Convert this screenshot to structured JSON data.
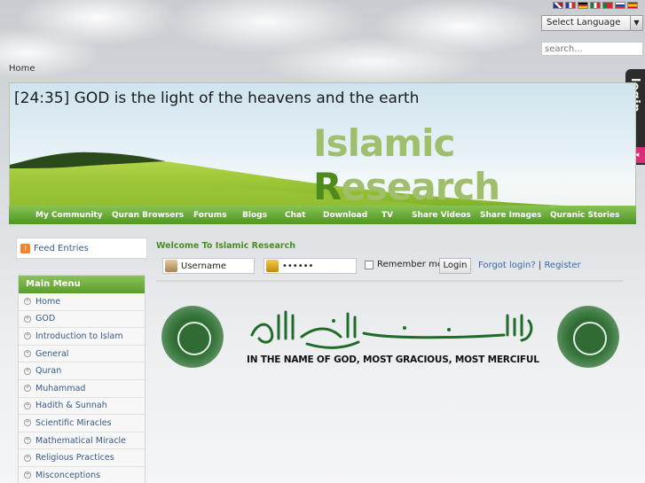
{
  "top": {
    "flags": [
      "flag-uk",
      "flag-fr",
      "flag-de",
      "flag-it",
      "flag-pt",
      "flag-ru",
      "flag-es"
    ],
    "language_select": "Select Language",
    "search_placeholder": "search..."
  },
  "breadcrumb": "Home",
  "login_tab": "login",
  "banner": {
    "verse": "[24:35] GOD is the light of the heavens and the earth",
    "brand_part1": "Islamic ",
    "brand_part2": "R",
    "brand_part3": "esearch"
  },
  "nav": [
    "My Community",
    "Quran Browsers",
    "Forums",
    "Blogs",
    "Chat",
    "Download",
    "TV",
    "Share Videos",
    "Share Images",
    "Quranic Stories"
  ],
  "feed": "Feed Entries",
  "main_menu": {
    "title": "Main Menu",
    "items": [
      "Home",
      "GOD",
      "Introduction to Islam",
      "General",
      "Quran",
      "Muhammad",
      "Hadith & Sunnah",
      "Scientific Miracles",
      "Mathematical Miracle",
      "Religious Practices",
      "Misconceptions"
    ]
  },
  "content": {
    "welcome": "Welcome To Islamic Research",
    "username_value": "Username",
    "password_value": "••••••",
    "remember": "Remember me",
    "login_button": "Login",
    "forgot": "Forgot login?",
    "separator": "|",
    "register": "Register",
    "caption": "IN THE NAME OF GOD, MOST GRACIOUS, MOST MERCIFUL"
  },
  "colors": {
    "accent_green": "#5b9c2c",
    "link_blue": "#3a5a86",
    "brand_light": "#9fbf6c",
    "brand_dark": "#4f8a1c"
  }
}
